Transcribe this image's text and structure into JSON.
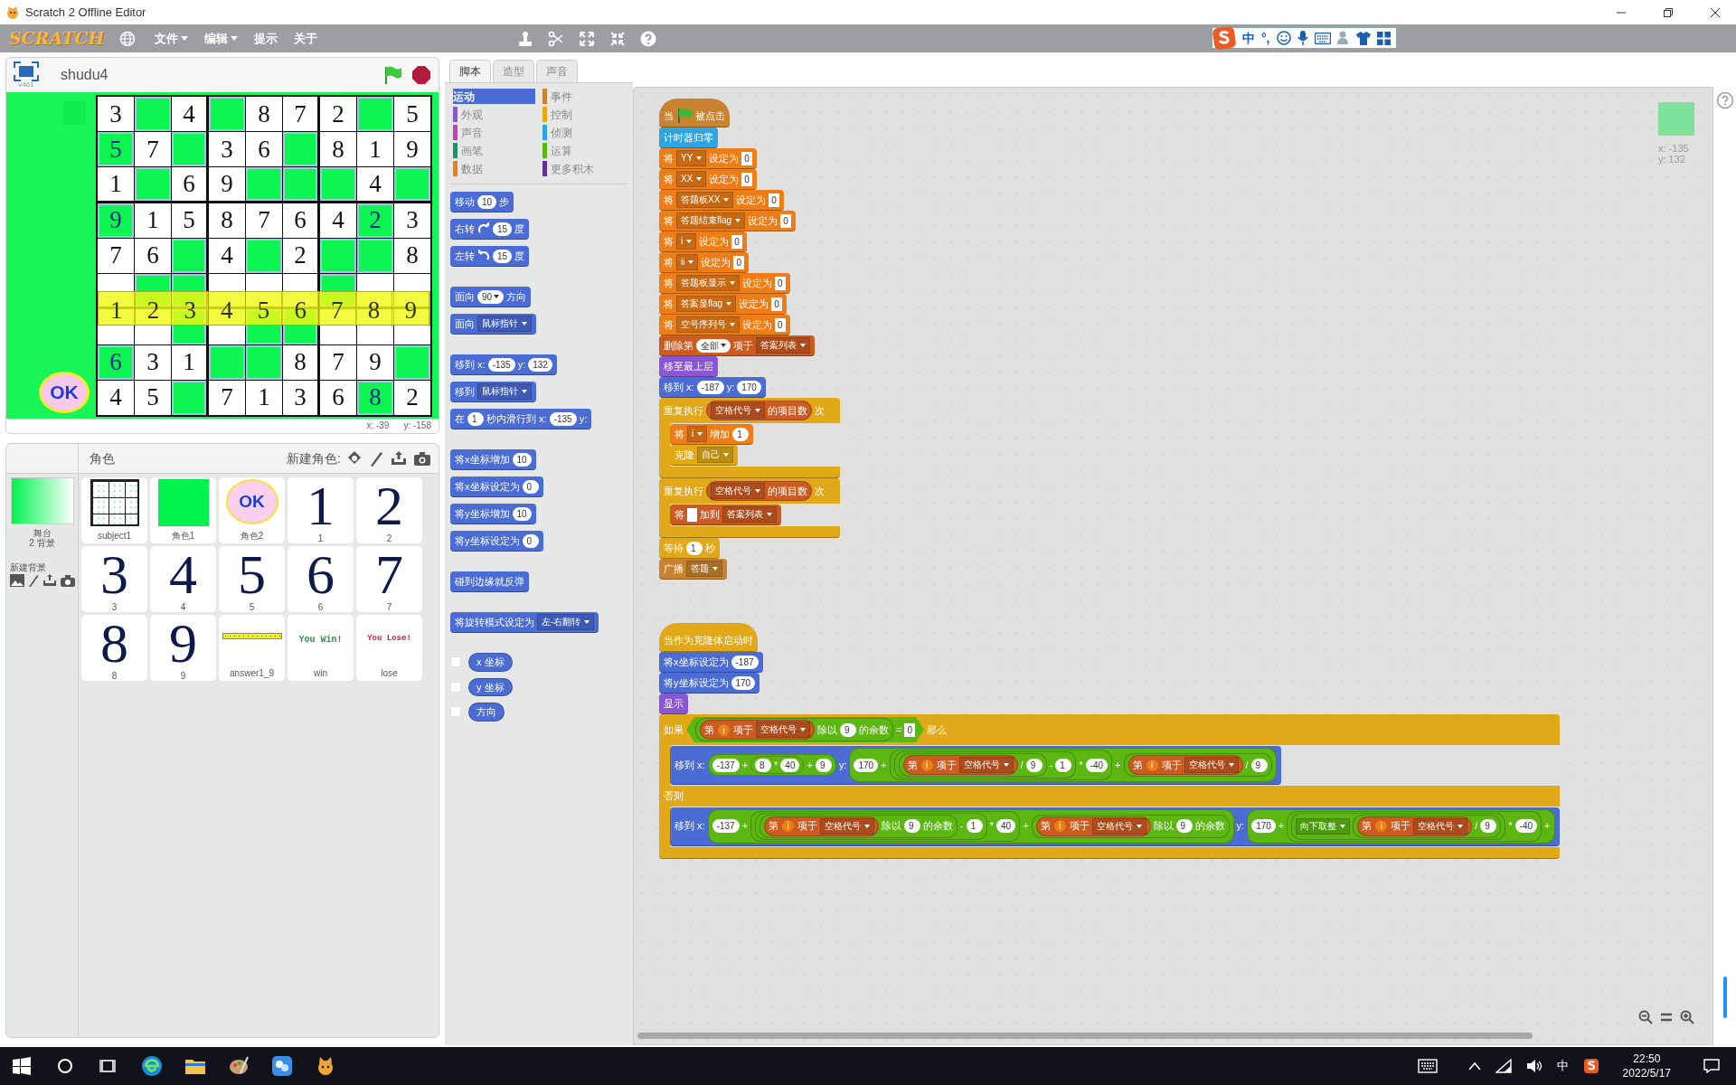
{
  "window": {
    "title": "Scratch 2 Offline Editor"
  },
  "menu": {
    "logo": "SCRATCH",
    "items": [
      {
        "label": "文件",
        "dropdown": true
      },
      {
        "label": "编辑",
        "dropdown": true
      },
      {
        "label": "提示",
        "dropdown": false
      },
      {
        "label": "关于",
        "dropdown": false
      }
    ]
  },
  "ime": {
    "lang": "中",
    "punct": "°,"
  },
  "stage": {
    "project": "shudu4",
    "version": "v461",
    "ok": "OK",
    "mouse_x": "x: -39",
    "mouse_y": "y: -158",
    "grid": [
      [
        {
          "kind": "given",
          "digit": "3"
        },
        {
          "kind": "empty"
        },
        {
          "kind": "given",
          "digit": "4"
        },
        {
          "kind": "empty"
        },
        {
          "kind": "given",
          "digit": "8"
        },
        {
          "kind": "given",
          "digit": "7"
        },
        {
          "kind": "given",
          "digit": "2"
        },
        {
          "kind": "empty"
        },
        {
          "kind": "given",
          "digit": "5"
        }
      ],
      [
        {
          "kind": "filled",
          "digit": "5"
        },
        {
          "kind": "given",
          "digit": "7"
        },
        {
          "kind": "empty"
        },
        {
          "kind": "given",
          "digit": "3"
        },
        {
          "kind": "given",
          "digit": "6"
        },
        {
          "kind": "empty"
        },
        {
          "kind": "given",
          "digit": "8"
        },
        {
          "kind": "given",
          "digit": "1"
        },
        {
          "kind": "given",
          "digit": "9"
        }
      ],
      [
        {
          "kind": "given",
          "digit": "1"
        },
        {
          "kind": "empty"
        },
        {
          "kind": "given",
          "digit": "6"
        },
        {
          "kind": "given",
          "digit": "9"
        },
        {
          "kind": "empty"
        },
        {
          "kind": "empty"
        },
        {
          "kind": "empty"
        },
        {
          "kind": "given",
          "digit": "4"
        },
        {
          "kind": "empty"
        }
      ],
      [
        {
          "kind": "filled",
          "digit": "9"
        },
        {
          "kind": "given",
          "digit": "1"
        },
        {
          "kind": "given",
          "digit": "5"
        },
        {
          "kind": "given",
          "digit": "8"
        },
        {
          "kind": "given",
          "digit": "7"
        },
        {
          "kind": "given",
          "digit": "6"
        },
        {
          "kind": "given",
          "digit": "4"
        },
        {
          "kind": "filled",
          "digit": "2"
        },
        {
          "kind": "given",
          "digit": "3"
        }
      ],
      [
        {
          "kind": "given",
          "digit": "7"
        },
        {
          "kind": "given",
          "digit": "6"
        },
        {
          "kind": "empty"
        },
        {
          "kind": "given",
          "digit": "4"
        },
        {
          "kind": "empty"
        },
        {
          "kind": "given",
          "digit": "2"
        },
        {
          "kind": "empty"
        },
        {
          "kind": "empty"
        },
        {
          "kind": "given",
          "digit": "8"
        }
      ],
      [
        {
          "kind": "covered"
        },
        {
          "kind": "empty"
        },
        {
          "kind": "empty"
        },
        {
          "kind": "covered"
        },
        {
          "kind": "covered"
        },
        {
          "kind": "covered"
        },
        {
          "kind": "empty"
        },
        {
          "kind": "covered"
        },
        {
          "kind": "covered"
        }
      ],
      [
        {
          "kind": "covered"
        },
        {
          "kind": "covered"
        },
        {
          "kind": "empty"
        },
        {
          "kind": "covered"
        },
        {
          "kind": "empty"
        },
        {
          "kind": "empty"
        },
        {
          "kind": "covered"
        },
        {
          "kind": "covered"
        },
        {
          "kind": "covered"
        }
      ],
      [
        {
          "kind": "filled",
          "digit": "6"
        },
        {
          "kind": "given",
          "digit": "3"
        },
        {
          "kind": "given",
          "digit": "1"
        },
        {
          "kind": "empty"
        },
        {
          "kind": "empty"
        },
        {
          "kind": "given",
          "digit": "8"
        },
        {
          "kind": "given",
          "digit": "7"
        },
        {
          "kind": "given",
          "digit": "9"
        },
        {
          "kind": "empty"
        }
      ],
      [
        {
          "kind": "given",
          "digit": "4"
        },
        {
          "kind": "given",
          "digit": "5"
        },
        {
          "kind": "empty"
        },
        {
          "kind": "given",
          "digit": "7"
        },
        {
          "kind": "given",
          "digit": "1"
        },
        {
          "kind": "given",
          "digit": "3"
        },
        {
          "kind": "given",
          "digit": "6"
        },
        {
          "kind": "filled",
          "digit": "8"
        },
        {
          "kind": "given",
          "digit": "2"
        }
      ]
    ],
    "answer_bar": [
      "1",
      "2",
      "3",
      "4",
      "5",
      "6",
      "7",
      "8",
      "9"
    ]
  },
  "sprites": {
    "title": "角色",
    "new_label": "新建角色:",
    "stage_label": "舞台",
    "backdrop_count": "2 背景",
    "new_backdrop": "新建背景",
    "items": [
      {
        "name": "subject1",
        "kind": "grid"
      },
      {
        "name": "角色1",
        "kind": "square"
      },
      {
        "name": "角色2",
        "kind": "ok",
        "text": "OK"
      },
      {
        "name": "1",
        "kind": "digit",
        "text": "1"
      },
      {
        "name": "2",
        "kind": "digit",
        "text": "2"
      },
      {
        "name": "3",
        "kind": "digit",
        "text": "3"
      },
      {
        "name": "4",
        "kind": "digit",
        "text": "4"
      },
      {
        "name": "5",
        "kind": "digit",
        "text": "5"
      },
      {
        "name": "6",
        "kind": "digit",
        "text": "6"
      },
      {
        "name": "7",
        "kind": "digit",
        "text": "7"
      },
      {
        "name": "8",
        "kind": "digit",
        "text": "8"
      },
      {
        "name": "9",
        "kind": "digit",
        "text": "9"
      },
      {
        "name": "answer1_9",
        "kind": "bar"
      },
      {
        "name": "win",
        "kind": "win",
        "text": "You Win!"
      },
      {
        "name": "lose",
        "kind": "lose",
        "text": "You Lose!"
      }
    ]
  },
  "tabs": [
    {
      "label": "脚本",
      "selected": true
    },
    {
      "label": "造型",
      "selected": false
    },
    {
      "label": "声音",
      "selected": false
    }
  ],
  "categories": [
    {
      "label": "运动",
      "color": "#4a6cd4",
      "selected": true
    },
    {
      "label": "事件",
      "color": "#c88330",
      "selected": false
    },
    {
      "label": "外观",
      "color": "#8a55d7",
      "selected": false
    },
    {
      "label": "控制",
      "color": "#e1a91a",
      "selected": false
    },
    {
      "label": "声音",
      "color": "#bb42c3",
      "selected": false
    },
    {
      "label": "侦测",
      "color": "#2ca5e2",
      "selected": false
    },
    {
      "label": "画笔",
      "color": "#0e9a6c",
      "selected": false
    },
    {
      "label": "运算",
      "color": "#5cb712",
      "selected": false
    },
    {
      "label": "数据",
      "color": "#ee7d16",
      "selected": false
    },
    {
      "label": "更多积木",
      "color": "#632d99",
      "selected": false
    }
  ],
  "palette": [
    [
      {
        "kind": "stack",
        "parts": [
          {
            "kind": "text",
            "text": "移动"
          },
          {
            "kind": "num",
            "text": "10"
          },
          {
            "kind": "text",
            "text": "步"
          }
        ]
      },
      {
        "kind": "stack",
        "parts": [
          {
            "kind": "text",
            "text": "右转"
          },
          {
            "kind": "cw"
          },
          {
            "kind": "num",
            "text": "15"
          },
          {
            "kind": "text",
            "text": "度"
          }
        ]
      },
      {
        "kind": "stack",
        "parts": [
          {
            "kind": "text",
            "text": "左转"
          },
          {
            "kind": "ccw"
          },
          {
            "kind": "num",
            "text": "15"
          },
          {
            "kind": "text",
            "text": "度"
          }
        ]
      }
    ],
    [
      {
        "kind": "stack",
        "parts": [
          {
            "kind": "text",
            "text": "面向"
          },
          {
            "kind": "num-menu",
            "text": "90"
          },
          {
            "kind": "text",
            "text": "方向"
          }
        ]
      },
      {
        "kind": "stack",
        "parts": [
          {
            "kind": "text",
            "text": "面向"
          },
          {
            "kind": "menu",
            "text": "鼠标指针"
          }
        ]
      }
    ],
    [
      {
        "kind": "stack",
        "parts": [
          {
            "kind": "text",
            "text": "移到 x:"
          },
          {
            "kind": "num",
            "text": "-135"
          },
          {
            "kind": "text",
            "text": "y:"
          },
          {
            "kind": "num",
            "text": "132"
          }
        ]
      },
      {
        "kind": "stack",
        "parts": [
          {
            "kind": "text",
            "text": "移到"
          },
          {
            "kind": "menu",
            "text": "鼠标指针"
          }
        ]
      },
      {
        "kind": "stack",
        "parts": [
          {
            "kind": "text",
            "text": "在"
          },
          {
            "kind": "num",
            "text": "1"
          },
          {
            "kind": "text",
            "text": "秒内滑行到 x:"
          },
          {
            "kind": "num",
            "text": "-135"
          },
          {
            "kind": "text",
            "text": "y:"
          }
        ]
      }
    ],
    [
      {
        "kind": "stack",
        "parts": [
          {
            "kind": "text",
            "text": "将x坐标增加"
          },
          {
            "kind": "num",
            "text": "10"
          }
        ]
      },
      {
        "kind": "stack",
        "parts": [
          {
            "kind": "text",
            "text": "将x坐标设定为"
          },
          {
            "kind": "num",
            "text": "0"
          }
        ]
      },
      {
        "kind": "stack",
        "parts": [
          {
            "kind": "text",
            "text": "将y坐标增加"
          },
          {
            "kind": "num",
            "text": "10"
          }
        ]
      },
      {
        "kind": "stack",
        "parts": [
          {
            "kind": "text",
            "text": "将y坐标设定为"
          },
          {
            "kind": "num",
            "text": "0"
          }
        ]
      }
    ],
    [
      {
        "kind": "stack",
        "parts": [
          {
            "kind": "text",
            "text": "碰到边缘就反弹"
          }
        ]
      }
    ],
    [
      {
        "kind": "stack",
        "parts": [
          {
            "kind": "text",
            "text": "将旋转模式设定为"
          },
          {
            "kind": "menu",
            "text": "左-右翻转"
          }
        ]
      }
    ],
    [
      {
        "kind": "reporter",
        "checked": false,
        "parts": [
          {
            "kind": "text",
            "text": "x 坐标"
          }
        ]
      },
      {
        "kind": "reporter",
        "checked": false,
        "parts": [
          {
            "kind": "text",
            "text": "y 坐标"
          }
        ]
      },
      {
        "kind": "reporter",
        "checked": false,
        "parts": [
          {
            "kind": "text",
            "text": "方向"
          }
        ]
      }
    ]
  ],
  "scripts": [
    [
      {
        "kind": "hat",
        "color": "#c88330",
        "parts": [
          {
            "kind": "text",
            "text": "当"
          },
          {
            "kind": "flag"
          },
          {
            "kind": "text",
            "text": "被点击"
          }
        ]
      },
      {
        "kind": "stack",
        "color": "#2ca5e2",
        "parts": [
          {
            "kind": "text",
            "text": "计时器归零"
          }
        ]
      },
      {
        "kind": "stack",
        "color": "#ee7d16",
        "parts": [
          {
            "kind": "text",
            "text": "将"
          },
          {
            "kind": "menu",
            "text": "YY"
          },
          {
            "kind": "text",
            "text": "设定为"
          },
          {
            "kind": "str",
            "text": "0"
          }
        ]
      },
      {
        "kind": "stack",
        "color": "#ee7d16",
        "parts": [
          {
            "kind": "text",
            "text": "将"
          },
          {
            "kind": "menu",
            "text": "XX"
          },
          {
            "kind": "text",
            "text": "设定为"
          },
          {
            "kind": "str",
            "text": "0"
          }
        ]
      },
      {
        "kind": "stack",
        "color": "#ee7d16",
        "parts": [
          {
            "kind": "text",
            "text": "将"
          },
          {
            "kind": "menu",
            "text": "答题板XX"
          },
          {
            "kind": "text",
            "text": "设定为"
          },
          {
            "kind": "str",
            "text": "0"
          }
        ]
      },
      {
        "kind": "stack",
        "color": "#ee7d16",
        "parts": [
          {
            "kind": "text",
            "text": "将"
          },
          {
            "kind": "menu",
            "text": "答题结束flag"
          },
          {
            "kind": "text",
            "text": "设定为"
          },
          {
            "kind": "str",
            "text": "0"
          }
        ]
      },
      {
        "kind": "stack",
        "color": "#ee7d16",
        "parts": [
          {
            "kind": "text",
            "text": "将"
          },
          {
            "kind": "menu",
            "text": "i"
          },
          {
            "kind": "text",
            "text": "设定为"
          },
          {
            "kind": "str",
            "text": "0"
          }
        ]
      },
      {
        "kind": "stack",
        "color": "#ee7d16",
        "parts": [
          {
            "kind": "text",
            "text": "将"
          },
          {
            "kind": "menu",
            "text": "ii"
          },
          {
            "kind": "text",
            "text": "设定为"
          },
          {
            "kind": "str",
            "text": "0"
          }
        ]
      },
      {
        "kind": "stack",
        "color": "#ee7d16",
        "parts": [
          {
            "kind": "text",
            "text": "将"
          },
          {
            "kind": "menu",
            "text": "答题板显示"
          },
          {
            "kind": "text",
            "text": "设定为"
          },
          {
            "kind": "str",
            "text": "0"
          }
        ]
      },
      {
        "kind": "stack",
        "color": "#ee7d16",
        "parts": [
          {
            "kind": "text",
            "text": "将"
          },
          {
            "kind": "menu",
            "text": "答案显flag"
          },
          {
            "kind": "text",
            "text": "设定为"
          },
          {
            "kind": "str",
            "text": "0"
          }
        ]
      },
      {
        "kind": "stack",
        "color": "#ee7d16",
        "parts": [
          {
            "kind": "text",
            "text": "将"
          },
          {
            "kind": "menu",
            "text": "空号序列号"
          },
          {
            "kind": "text",
            "text": "设定为"
          },
          {
            "kind": "str",
            "text": "0"
          }
        ]
      },
      {
        "kind": "stack",
        "color": "#cc5b22",
        "parts": [
          {
            "kind": "text",
            "text": "删除第"
          },
          {
            "kind": "num-menu",
            "text": "全部"
          },
          {
            "kind": "text",
            "text": "项于"
          },
          {
            "kind": "menu",
            "text": "答案列表"
          }
        ]
      },
      {
        "kind": "stack",
        "color": "#8a55d7",
        "parts": [
          {
            "kind": "text",
            "text": "移至最上层"
          }
        ]
      },
      {
        "kind": "stack",
        "color": "#4a6cd4",
        "parts": [
          {
            "kind": "text",
            "text": "移到 x:"
          },
          {
            "kind": "num",
            "text": "-187"
          },
          {
            "kind": "text",
            "text": "y:"
          },
          {
            "kind": "num",
            "text": "170"
          }
        ]
      },
      {
        "kind": "c",
        "color": "#e1a91a",
        "parts": [
          {
            "kind": "text",
            "text": "重复执行"
          },
          {
            "kind": "list",
            "parts": [
              {
                "kind": "menu",
                "text": "空格代号"
              },
              {
                "kind": "text",
                "text": "的项目数"
              }
            ]
          },
          {
            "kind": "text",
            "text": "次"
          }
        ],
        "body": [
          {
            "kind": "stack",
            "color": "#ee7d16",
            "parts": [
              {
                "kind": "text",
                "text": "将"
              },
              {
                "kind": "menu",
                "text": "i"
              },
              {
                "kind": "text",
                "text": "增加"
              },
              {
                "kind": "num",
                "text": "1"
              }
            ]
          },
          {
            "kind": "stack",
            "color": "#e1a91a",
            "parts": [
              {
                "kind": "text",
                "text": "克隆"
              },
              {
                "kind": "menu",
                "text": "自己"
              }
            ]
          }
        ]
      },
      {
        "kind": "c",
        "color": "#e1a91a",
        "parts": [
          {
            "kind": "text",
            "text": "重复执行"
          },
          {
            "kind": "list",
            "parts": [
              {
                "kind": "menu",
                "text": "空格代号"
              },
              {
                "kind": "text",
                "text": "的项目数"
              }
            ]
          },
          {
            "kind": "text",
            "text": "次"
          }
        ],
        "body": [
          {
            "kind": "stack",
            "color": "#cc5b22",
            "parts": [
              {
                "kind": "text",
                "text": "将"
              },
              {
                "kind": "blank"
              },
              {
                "kind": "text",
                "text": "加到"
              },
              {
                "kind": "menu",
                "text": "答案列表"
              }
            ]
          }
        ]
      },
      {
        "kind": "stack",
        "color": "#e1a91a",
        "parts": [
          {
            "kind": "text",
            "text": "等待"
          },
          {
            "kind": "num",
            "text": "1"
          },
          {
            "kind": "text",
            "text": "秒"
          }
        ]
      },
      {
        "kind": "stack",
        "color": "#c88330",
        "parts": [
          {
            "kind": "text",
            "text": "广播"
          },
          {
            "kind": "menu",
            "text": "答题"
          }
        ]
      }
    ],
    [
      {
        "kind": "hat",
        "color": "#e1a91a",
        "parts": [
          {
            "kind": "text",
            "text": "当作为克隆体启动时"
          }
        ]
      },
      {
        "kind": "stack",
        "color": "#4a6cd4",
        "parts": [
          {
            "kind": "text",
            "text": "将x坐标设定为"
          },
          {
            "kind": "num",
            "text": "-187"
          }
        ]
      },
      {
        "kind": "stack",
        "color": "#4a6cd4",
        "parts": [
          {
            "kind": "text",
            "text": "将y坐标设定为"
          },
          {
            "kind": "num",
            "text": "170"
          }
        ]
      },
      {
        "kind": "stack",
        "color": "#8a55d7",
        "parts": [
          {
            "kind": "text",
            "text": "显示"
          }
        ]
      },
      {
        "kind": "ifelse",
        "color": "#e1a91a",
        "else_label": "否则",
        "parts": [
          {
            "kind": "text",
            "text": "如果"
          },
          {
            "kind": "bool",
            "parts": [
              {
                "kind": "op",
                "parts": [
                  {
                    "kind": "list",
                    "parts": [
                      {
                        "kind": "text",
                        "text": "第"
                      },
                      {
                        "kind": "var",
                        "text": "i"
                      },
                      {
                        "kind": "text",
                        "text": "项于"
                      },
                      {
                        "kind": "menu",
                        "text": "空格代号"
                      }
                    ]
                  },
                  {
                    "kind": "text",
                    "text": "除以"
                  },
                  {
                    "kind": "num",
                    "text": "9"
                  },
                  {
                    "kind": "text",
                    "text": "的余数"
                  }
                ]
              },
              {
                "kind": "text",
                "text": "="
              },
              {
                "kind": "str",
                "text": "0"
              }
            ]
          },
          {
            "kind": "text",
            "text": "那么"
          }
        ],
        "body": [
          {
            "kind": "stack",
            "color": "#4a6cd4",
            "parts": [
              {
                "kind": "text",
                "text": "移到 x:"
              },
              {
                "kind": "op",
                "parts": [
                  {
                    "kind": "num",
                    "text": "-137"
                  },
                  {
                    "kind": "text",
                    "text": "+"
                  },
                  {
                    "kind": "op",
                    "parts": [
                      {
                        "kind": "num",
                        "text": "8"
                      },
                      {
                        "kind": "text",
                        "text": "*"
                      },
                      {
                        "kind": "num",
                        "text": "40"
                      }
                    ]
                  },
                  {
                    "kind": "text",
                    "text": "+"
                  },
                  {
                    "kind": "num",
                    "text": "9"
                  }
                ]
              },
              {
                "kind": "text",
                "text": "y:"
              },
              {
                "kind": "op",
                "parts": [
                  {
                    "kind": "num",
                    "text": "170"
                  },
                  {
                    "kind": "text",
                    "text": "+"
                  },
                  {
                    "kind": "op",
                    "parts": [
                      {
                        "kind": "op",
                        "parts": [
                          {
                            "kind": "op",
                            "parts": [
                              {
                                "kind": "list",
                                "parts": [
                                  {
                                    "kind": "text",
                                    "text": "第"
                                  },
                                  {
                                    "kind": "var",
                                    "text": "i"
                                  },
                                  {
                                    "kind": "text",
                                    "text": "项于"
                                  },
                                  {
                                    "kind": "menu",
                                    "text": "空格代号"
                                  }
                                ]
                              },
                              {
                                "kind": "text",
                                "text": "/"
                              },
                              {
                                "kind": "num",
                                "text": "9"
                              }
                            ]
                          },
                          {
                            "kind": "text",
                            "text": "-"
                          },
                          {
                            "kind": "num",
                            "text": "1"
                          }
                        ]
                      },
                      {
                        "kind": "text",
                        "text": "*"
                      },
                      {
                        "kind": "num",
                        "text": "-40"
                      }
                    ]
                  },
                  {
                    "kind": "text",
                    "text": "+"
                  },
                  {
                    "kind": "op",
                    "parts": [
                      {
                        "kind": "list",
                        "parts": [
                          {
                            "kind": "text",
                            "text": "第"
                          },
                          {
                            "kind": "var",
                            "text": "i"
                          },
                          {
                            "kind": "text",
                            "text": "项于"
                          },
                          {
                            "kind": "menu",
                            "text": "空格代号"
                          }
                        ]
                      },
                      {
                        "kind": "text",
                        "text": "/"
                      },
                      {
                        "kind": "num",
                        "text": "9"
                      }
                    ]
                  }
                ]
              }
            ]
          }
        ],
        "else_body": [
          {
            "kind": "stack",
            "color": "#4a6cd4",
            "parts": [
              {
                "kind": "text",
                "text": "移到 x:"
              },
              {
                "kind": "op",
                "parts": [
                  {
                    "kind": "num",
                    "text": "-137"
                  },
                  {
                    "kind": "text",
                    "text": "+"
                  },
                  {
                    "kind": "op",
                    "parts": [
                      {
                        "kind": "op",
                        "parts": [
                          {
                            "kind": "op",
                            "parts": [
                              {
                                "kind": "list",
                                "parts": [
                                  {
                                    "kind": "text",
                                    "text": "第"
                                  },
                                  {
                                    "kind": "var",
                                    "text": "i"
                                  },
                                  {
                                    "kind": "text",
                                    "text": "项于"
                                  },
                                  {
                                    "kind": "menu",
                                    "text": "空格代号"
                                  }
                                ]
                              },
                              {
                                "kind": "text",
                                "text": "除以"
                              },
                              {
                                "kind": "num",
                                "text": "9"
                              },
                              {
                                "kind": "text",
                                "text": "的余数"
                              }
                            ]
                          },
                          {
                            "kind": "text",
                            "text": "-"
                          },
                          {
                            "kind": "num",
                            "text": "1"
                          }
                        ]
                      },
                      {
                        "kind": "text",
                        "text": "*"
                      },
                      {
                        "kind": "num",
                        "text": "40"
                      }
                    ]
                  },
                  {
                    "kind": "text",
                    "text": "+"
                  },
                  {
                    "kind": "op",
                    "parts": [
                      {
                        "kind": "list",
                        "parts": [
                          {
                            "kind": "text",
                            "text": "第"
                          },
                          {
                            "kind": "var",
                            "text": "i"
                          },
                          {
                            "kind": "text",
                            "text": "项于"
                          },
                          {
                            "kind": "menu",
                            "text": "空格代号"
                          }
                        ]
                      },
                      {
                        "kind": "text",
                        "text": "除以"
                      },
                      {
                        "kind": "num",
                        "text": "9"
                      },
                      {
                        "kind": "text",
                        "text": "的余数"
                      }
                    ]
                  }
                ]
              },
              {
                "kind": "text",
                "text": "y:"
              },
              {
                "kind": "op",
                "parts": [
                  {
                    "kind": "num",
                    "text": "170"
                  },
                  {
                    "kind": "text",
                    "text": "+"
                  },
                  {
                    "kind": "op",
                    "parts": [
                      {
                        "kind": "op",
                        "parts": [
                          {
                            "kind": "menu",
                            "text": "向下取整"
                          },
                          {
                            "kind": "op",
                            "parts": [
                              {
                                "kind": "list",
                                "parts": [
                                  {
                                    "kind": "text",
                                    "text": "第"
                                  },
                                  {
                                    "kind": "var",
                                    "text": "i"
                                  },
                                  {
                                    "kind": "text",
                                    "text": "项于"
                                  },
                                  {
                                    "kind": "menu",
                                    "text": "空格代号"
                                  }
                                ]
                              },
                              {
                                "kind": "text",
                                "text": "/"
                              },
                              {
                                "kind": "num",
                                "text": "9"
                              }
                            ]
                          }
                        ]
                      },
                      {
                        "kind": "text",
                        "text": "*"
                      },
                      {
                        "kind": "num",
                        "text": "-40"
                      }
                    ]
                  },
                  {
                    "kind": "text",
                    "text": "+"
                  }
                ]
              }
            ]
          }
        ]
      }
    ]
  ],
  "sprite_info": {
    "x": "x: -135",
    "y": "y: 132"
  },
  "taskbar": {
    "ime": "中",
    "time": "22:50",
    "date": "2022/5/17"
  }
}
